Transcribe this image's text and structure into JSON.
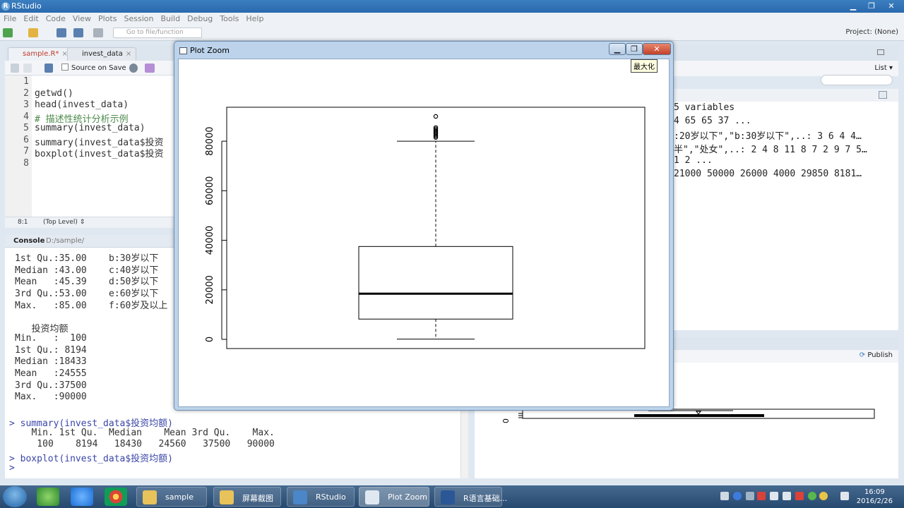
{
  "app": {
    "title": "RStudio"
  },
  "window_controls": {
    "minimize": "▁",
    "maximize": "❐",
    "close": "✕"
  },
  "menu": [
    "File",
    "Edit",
    "Code",
    "View",
    "Plots",
    "Session",
    "Build",
    "Debug",
    "Tools",
    "Help"
  ],
  "toolbar": {
    "goto_placeholder": "Go to file/function",
    "project": "Project: (None)"
  },
  "editor": {
    "tabs": [
      {
        "label": "sample.R*"
      },
      {
        "label": "invest_data"
      }
    ],
    "source_on_save": "Source on Save",
    "lines": [
      {
        "n": "1",
        "code": ""
      },
      {
        "n": "2",
        "code": "getwd()"
      },
      {
        "n": "3",
        "code": "head(invest_data)"
      },
      {
        "n": "4",
        "code": "# 描述性统计分析示例"
      },
      {
        "n": "5",
        "code": "summary(invest_data)"
      },
      {
        "n": "6",
        "code": "summary(invest_data$投资"
      },
      {
        "n": "7",
        "code": "boxplot(invest_data$投资"
      },
      {
        "n": "8",
        "code": ""
      }
    ],
    "status_pos": "8:1",
    "status_scope": "(Top Level) ⇕"
  },
  "console": {
    "label": "Console",
    "path": "D:/sample/",
    "lines": [
      {
        "text": "1st Qu.:35.00    b:30岁以下",
        "in": false
      },
      {
        "text": "Median :43.00    c:40岁以下",
        "in": false
      },
      {
        "text": "Mean   :45.39    d:50岁以下",
        "in": false
      },
      {
        "text": "3rd Qu.:53.00    e:60岁以下",
        "in": false
      },
      {
        "text": "Max.   :85.00    f:60岁及以上",
        "in": false
      },
      {
        "text": "",
        "in": false
      },
      {
        "text": "   投资均额",
        "in": false
      },
      {
        "text": "Min.   :  100",
        "in": false
      },
      {
        "text": "1st Qu.: 8194",
        "in": false
      },
      {
        "text": "Median :18433",
        "in": false
      },
      {
        "text": "Mean   :24555",
        "in": false
      },
      {
        "text": "3rd Qu.:37500",
        "in": false
      },
      {
        "text": "Max.   :90000",
        "in": false
      },
      {
        "text": "",
        "in": false
      },
      {
        "text": "> summary(invest_data$投资均额)",
        "in": true
      },
      {
        "text": "   Min. 1st Qu.  Median    Mean 3rd Qu.    Max.",
        "in": false
      },
      {
        "text": "    100    8194   18430   24560   37500   90000",
        "in": false
      },
      {
        "text": "> boxplot(invest_data$投资均额)",
        "in": true
      },
      {
        "text": "> ",
        "in": true
      }
    ]
  },
  "environment": {
    "list_label": "List ▾",
    "tabs": [
      "Environment",
      "History"
    ],
    "lines": [
      "5 variables",
      "4 65 65 37 ...",
      ":20岁以下\",\"b:30岁以下\",..: 3 6 4 4…",
      "半\",\"处女\",..: 2 4 8 11 8 7 2 9 7 5…",
      "1 2 ...",
      "21000 50000 26000 4000 29850 8181…"
    ]
  },
  "files_pane": {
    "publish": "Publish",
    "axis_zero": "0"
  },
  "plot_zoom": {
    "title": "Plot Zoom",
    "maximize_tooltip": "最大化"
  },
  "chart_data": {
    "type": "boxplot",
    "title": "",
    "xlabel": "",
    "ylabel": "",
    "ylim": [
      0,
      90000
    ],
    "yticks": [
      0,
      20000,
      40000,
      60000,
      80000
    ],
    "min": 100,
    "q1": 8194,
    "median": 18433,
    "q3": 37500,
    "whisker_high": 80000,
    "outliers": [
      81500,
      82000,
      82500,
      83000,
      83500,
      84000,
      84500,
      85000,
      85500,
      90000
    ]
  },
  "taskbar": {
    "items": [
      {
        "label": "sample",
        "color": "#e8c25a",
        "active": false
      },
      {
        "label": "屏幕截图",
        "color": "#e8c25a",
        "active": false
      },
      {
        "label": "RStudio",
        "color": "#4a86c8",
        "active": false
      },
      {
        "label": "Plot Zoom",
        "color": "#dfe8f1",
        "active": true
      },
      {
        "label": "R语言基础...",
        "color": "#2b5797",
        "active": false
      }
    ],
    "time": "16:09",
    "date": "2016/2/26"
  }
}
